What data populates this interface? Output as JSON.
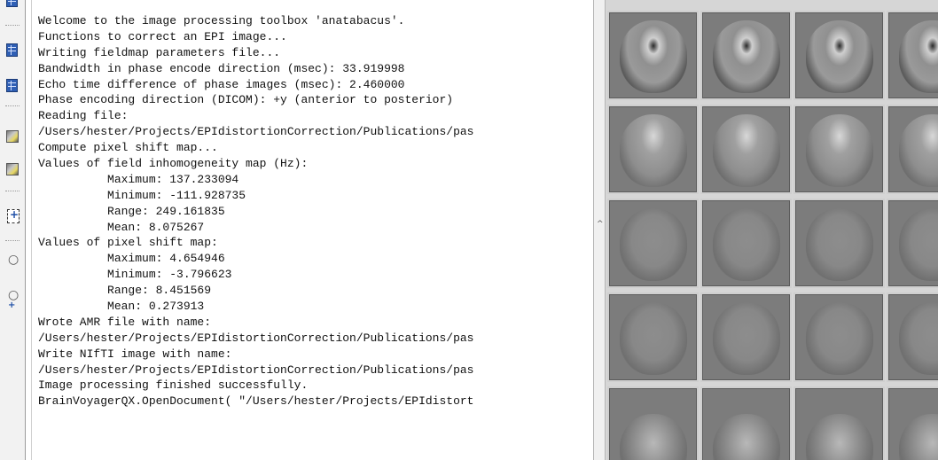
{
  "log": {
    "lines": [
      "Welcome to the image processing toolbox 'anatabacus'.",
      "Functions to correct an EPI image...",
      "Writing fieldmap parameters file...",
      "Bandwidth in phase encode direction (msec): 33.919998",
      "Echo time difference of phase images (msec): 2.460000",
      "Phase encoding direction (DICOM): +y (anterior to posterior)",
      "Reading file:",
      "/Users/hester/Projects/EPIdistortionCorrection/Publications/pas",
      "Compute pixel shift map...",
      "Values of field inhomogeneity map (Hz):",
      "          Maximum: 137.233094",
      "          Minimum: -111.928735",
      "          Range: 249.161835",
      "          Mean: 8.075267",
      "Values of pixel shift map:",
      "          Maximum: 4.654946",
      "          Minimum: -3.796623",
      "          Range: 8.451569",
      "          Mean: 0.273913",
      "Wrote AMR file with name:",
      "/Users/hester/Projects/EPIdistortionCorrection/Publications/pas",
      "Write NIfTI image with name:",
      "/Users/hester/Projects/EPIdistortionCorrection/Publications/pas",
      "Image processing finished successfully.",
      "BrainVoyagerQX.OpenDocument( \"/Users/hester/Projects/EPIdistort"
    ]
  },
  "toolbar": {
    "icons": [
      "grid-icon",
      "grid-icon",
      "image-icon",
      "image-icon",
      "star-select-icon",
      "lasso-icon",
      "lasso-add-icon"
    ]
  },
  "viewer": {
    "rows": 5,
    "columns": 4
  }
}
